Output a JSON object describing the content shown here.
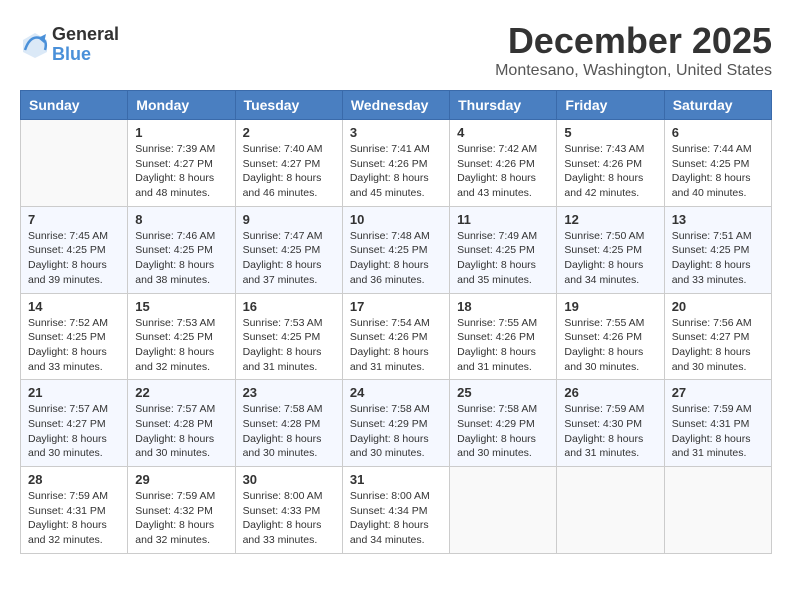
{
  "header": {
    "logo_general": "General",
    "logo_blue": "Blue",
    "month_title": "December 2025",
    "subtitle": "Montesano, Washington, United States"
  },
  "days_of_week": [
    "Sunday",
    "Monday",
    "Tuesday",
    "Wednesday",
    "Thursday",
    "Friday",
    "Saturday"
  ],
  "weeks": [
    [
      {
        "day": "",
        "info": ""
      },
      {
        "day": "1",
        "info": "Sunrise: 7:39 AM\nSunset: 4:27 PM\nDaylight: 8 hours\nand 48 minutes."
      },
      {
        "day": "2",
        "info": "Sunrise: 7:40 AM\nSunset: 4:27 PM\nDaylight: 8 hours\nand 46 minutes."
      },
      {
        "day": "3",
        "info": "Sunrise: 7:41 AM\nSunset: 4:26 PM\nDaylight: 8 hours\nand 45 minutes."
      },
      {
        "day": "4",
        "info": "Sunrise: 7:42 AM\nSunset: 4:26 PM\nDaylight: 8 hours\nand 43 minutes."
      },
      {
        "day": "5",
        "info": "Sunrise: 7:43 AM\nSunset: 4:26 PM\nDaylight: 8 hours\nand 42 minutes."
      },
      {
        "day": "6",
        "info": "Sunrise: 7:44 AM\nSunset: 4:25 PM\nDaylight: 8 hours\nand 40 minutes."
      }
    ],
    [
      {
        "day": "7",
        "info": "Sunrise: 7:45 AM\nSunset: 4:25 PM\nDaylight: 8 hours\nand 39 minutes."
      },
      {
        "day": "8",
        "info": "Sunrise: 7:46 AM\nSunset: 4:25 PM\nDaylight: 8 hours\nand 38 minutes."
      },
      {
        "day": "9",
        "info": "Sunrise: 7:47 AM\nSunset: 4:25 PM\nDaylight: 8 hours\nand 37 minutes."
      },
      {
        "day": "10",
        "info": "Sunrise: 7:48 AM\nSunset: 4:25 PM\nDaylight: 8 hours\nand 36 minutes."
      },
      {
        "day": "11",
        "info": "Sunrise: 7:49 AM\nSunset: 4:25 PM\nDaylight: 8 hours\nand 35 minutes."
      },
      {
        "day": "12",
        "info": "Sunrise: 7:50 AM\nSunset: 4:25 PM\nDaylight: 8 hours\nand 34 minutes."
      },
      {
        "day": "13",
        "info": "Sunrise: 7:51 AM\nSunset: 4:25 PM\nDaylight: 8 hours\nand 33 minutes."
      }
    ],
    [
      {
        "day": "14",
        "info": "Sunrise: 7:52 AM\nSunset: 4:25 PM\nDaylight: 8 hours\nand 33 minutes."
      },
      {
        "day": "15",
        "info": "Sunrise: 7:53 AM\nSunset: 4:25 PM\nDaylight: 8 hours\nand 32 minutes."
      },
      {
        "day": "16",
        "info": "Sunrise: 7:53 AM\nSunset: 4:25 PM\nDaylight: 8 hours\nand 31 minutes."
      },
      {
        "day": "17",
        "info": "Sunrise: 7:54 AM\nSunset: 4:26 PM\nDaylight: 8 hours\nand 31 minutes."
      },
      {
        "day": "18",
        "info": "Sunrise: 7:55 AM\nSunset: 4:26 PM\nDaylight: 8 hours\nand 31 minutes."
      },
      {
        "day": "19",
        "info": "Sunrise: 7:55 AM\nSunset: 4:26 PM\nDaylight: 8 hours\nand 30 minutes."
      },
      {
        "day": "20",
        "info": "Sunrise: 7:56 AM\nSunset: 4:27 PM\nDaylight: 8 hours\nand 30 minutes."
      }
    ],
    [
      {
        "day": "21",
        "info": "Sunrise: 7:57 AM\nSunset: 4:27 PM\nDaylight: 8 hours\nand 30 minutes."
      },
      {
        "day": "22",
        "info": "Sunrise: 7:57 AM\nSunset: 4:28 PM\nDaylight: 8 hours\nand 30 minutes."
      },
      {
        "day": "23",
        "info": "Sunrise: 7:58 AM\nSunset: 4:28 PM\nDaylight: 8 hours\nand 30 minutes."
      },
      {
        "day": "24",
        "info": "Sunrise: 7:58 AM\nSunset: 4:29 PM\nDaylight: 8 hours\nand 30 minutes."
      },
      {
        "day": "25",
        "info": "Sunrise: 7:58 AM\nSunset: 4:29 PM\nDaylight: 8 hours\nand 30 minutes."
      },
      {
        "day": "26",
        "info": "Sunrise: 7:59 AM\nSunset: 4:30 PM\nDaylight: 8 hours\nand 31 minutes."
      },
      {
        "day": "27",
        "info": "Sunrise: 7:59 AM\nSunset: 4:31 PM\nDaylight: 8 hours\nand 31 minutes."
      }
    ],
    [
      {
        "day": "28",
        "info": "Sunrise: 7:59 AM\nSunset: 4:31 PM\nDaylight: 8 hours\nand 32 minutes."
      },
      {
        "day": "29",
        "info": "Sunrise: 7:59 AM\nSunset: 4:32 PM\nDaylight: 8 hours\nand 32 minutes."
      },
      {
        "day": "30",
        "info": "Sunrise: 8:00 AM\nSunset: 4:33 PM\nDaylight: 8 hours\nand 33 minutes."
      },
      {
        "day": "31",
        "info": "Sunrise: 8:00 AM\nSunset: 4:34 PM\nDaylight: 8 hours\nand 34 minutes."
      },
      {
        "day": "",
        "info": ""
      },
      {
        "day": "",
        "info": ""
      },
      {
        "day": "",
        "info": ""
      }
    ]
  ]
}
